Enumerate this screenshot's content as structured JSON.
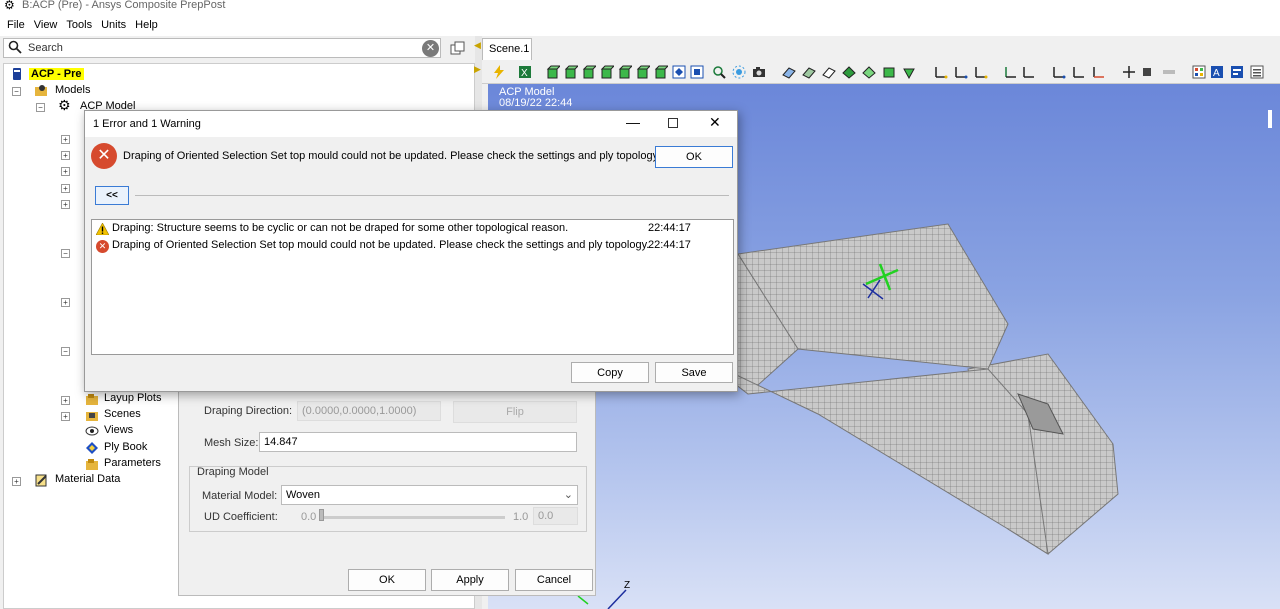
{
  "window": {
    "title": "B:ACP (Pre) - Ansys Composite PrepPost"
  },
  "menu": [
    "File",
    "View",
    "Tools",
    "Units",
    "Help"
  ],
  "search": {
    "label": "Search"
  },
  "tree": {
    "root": "ACP - Pre",
    "models": "Models",
    "acp_model": "ACP Model",
    "layup_plots": "Layup Plots",
    "scenes": "Scenes",
    "views": "Views",
    "ply_book": "Ply Book",
    "parameters": "Parameters",
    "material_data": "Material Data"
  },
  "tabs": {
    "scene": "Scene.1"
  },
  "viewport": {
    "model_name": "ACP Model",
    "date": "08/19/22 22:44",
    "axis_label": "Z"
  },
  "properties": {
    "draping_direction_label": "Draping Direction:",
    "draping_direction_value": "(0.0000,0.0000,1.0000)",
    "flip_label": "Flip",
    "mesh_size_label": "Mesh Size:",
    "mesh_size_value": "14.847",
    "draping_model_group": "Draping Model",
    "material_model_label": "Material Model:",
    "material_model_value": "Woven",
    "ud_coefficient_label": "UD Coefficient:",
    "ud_min": "0.0",
    "ud_max": "1.0",
    "ud_value": "0.0",
    "ok": "OK",
    "apply": "Apply",
    "cancel": "Cancel"
  },
  "dialog": {
    "title": "1 Error and 1 Warning",
    "message": "Draping of Oriented Selection Set top mould could not be updated. Please check the settings and ply topology.",
    "ok": "OK",
    "collapse": "<<",
    "log": [
      {
        "level": "warning",
        "text": "Draping: Structure seems to be cyclic or can not be draped for some other topological reason.",
        "time": "22:44:17"
      },
      {
        "level": "error",
        "text": "Draping of Oriented Selection Set top mould could not be updated. Please check the settings and ply topology.",
        "time": "22:44:17"
      }
    ],
    "copy": "Copy",
    "save": "Save"
  },
  "colors": {
    "error": "#d64a2e",
    "warning": "#f2c200",
    "highlight": "#ffff00",
    "viewport_top": "#6b87d9",
    "viewport_bottom": "#d9e1f6"
  }
}
